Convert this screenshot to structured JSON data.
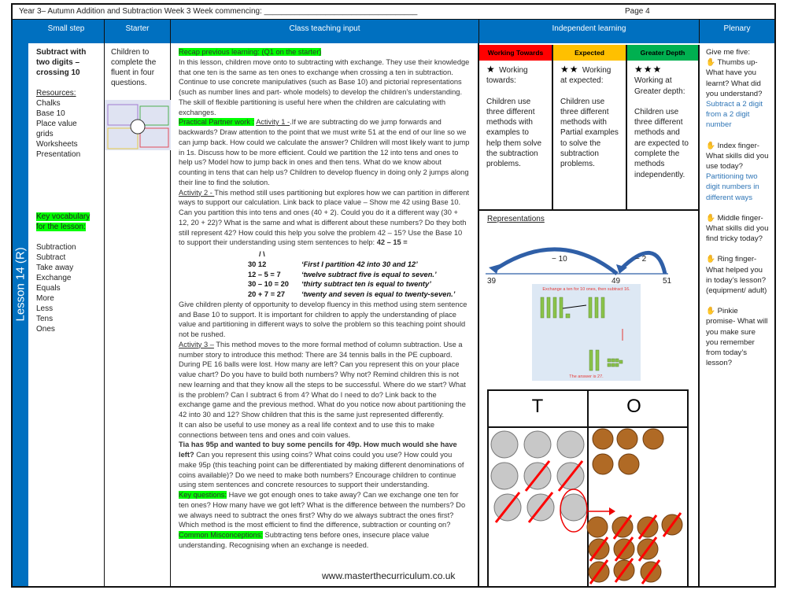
{
  "title": "Year 3– Autumn Addition and Subtraction Week 3   Week commencing: ___________________________________",
  "page": "Page 4",
  "lesson": "Lesson 14 (R)",
  "headers": {
    "small_step": "Small step",
    "starter": "Starter",
    "teaching": "Class teaching input",
    "independent": "Independent learning",
    "plenary": "Plenary"
  },
  "small_step": {
    "title": "Subtract with two digits – crossing 10",
    "resources_label": "Resources:",
    "resources": [
      "Chalks",
      "Base 10",
      "Place value grids",
      "Worksheets",
      "Presentation"
    ],
    "vocab_label": "Key vocabulary for the lesson:",
    "vocab": [
      "Subtraction",
      "Subtract",
      "Take away",
      "Exchange",
      "Equals",
      "More",
      "Less",
      "Tens",
      "Ones"
    ]
  },
  "starter": {
    "text": "Children to complete the fluent in four questions."
  },
  "teaching": {
    "paragraphs": [
      [
        {
          "t": "Recap previous learning: (Q1 on the starter)",
          "s": "hl"
        }
      ],
      [
        {
          "t": "In this lesson, children move onto to subtracting with exchange. They use their knowledge that one ten is the same as ten ones to exchange when crossing a ten in subtraction. Continue to use concrete manipulatives (such as Base 10) and pictorial representations (such as number lines and part- whole models) to develop the children’s understanding. The skill of flexible partitioning is useful here when the children are calculating with exchanges."
        }
      ],
      [
        {
          "t": "Practical Partner work :",
          "s": "hl"
        },
        {
          "t": " "
        },
        {
          "t": "Activity 1 -",
          "s": "u"
        },
        {
          "t": ".If we are subtracting do we jump forwards and backwards?  Draw attention to the point that  we must write 51 at the end of our line so we can jump back.  How could we calculate the answer? Children will most likely want to jump in 1s.  Discuss how to be more efficient.  Could we partition the 12 into tens and ones to help us?  Model how to jump back in ones and then tens.  What do we know about counting in tens that can help us?  Children to develop fluency in doing only 2 jumps along their line to find the solution."
        }
      ],
      [
        {
          "t": "Activity 2 -  ",
          "s": "u"
        },
        {
          "t": " This method still uses partitioning but explores how we can partition in different ways to support our calculation. Link back to place value – Show me 42 using Base 10.  Can you partition this into tens and ones (40 + 2).  Could you do it a different way (30 + 12, 20 + 22)?  What is the same and what is different about these numbers? Do they both still  represent 42? How could this help you solve the problem 42 – 15? Use the Base 10 to support their understanding using stem sentences to help:  "
        },
        {
          "t": "42 – 15 =",
          "s": "b"
        }
      ]
    ],
    "stems": {
      "branch": "/   \\",
      "rows": [
        [
          "30     12",
          "‘First I partition 42 into 30 and 12’"
        ],
        [
          "12 – 5 = 7",
          "‘twelve subtract five is equal to seven.’"
        ],
        [
          "30 –  10 = 20",
          "‘thirty subtract ten is equal to twenty’"
        ],
        [
          "20 + 7 = 27",
          "‘twenty and seven is equal to twenty-seven.’"
        ]
      ]
    },
    "paragraphs2": [
      [
        {
          "t": "Give children plenty of opportunity to develop fluency in this method using stem sentence and Base 10 to support. It is important for children to apply the understanding of place value and partitioning in different ways to solve the problem so this teaching point should not be rushed."
        }
      ],
      [
        {
          "t": "Activity 3 –",
          "s": "u"
        },
        {
          "t": " This method moves to the more formal method of column subtraction. Use a number story to introduce this method:  There are 34 tennis balls in the PE cupboard.  During PE 16 balls were lost. How many are left?  Can you represent this on your place value chart? Do you have to build both numbers? Why not?   Remind children this is not new learning and that they know all the steps to be successful. Where do we start?  What is the problem?  Can I subtract 6 from 4?  What do I need to do? Link back to the exchange game and the previous method.  What do you notice now about partitioning the 42 into 30 and 12?   Show children that this is the same just represented differently."
        }
      ],
      [
        {
          "t": "It can also  be useful to use money as a real life context and to use this to make connections between  tens and ones and coin values."
        }
      ],
      [
        {
          "t": "Tia has 95p and wanted to buy some pencils for 49p. How much would she have left?",
          "s": "b"
        },
        {
          "t": " Can you represent this using coins?  What coins could you use?  How could you make 95p  (this teaching point can be differentiated by making different denominations of coins available)?   Do we need to make both numbers?   Encourage children to continue using stem sentences and concrete resources to support their understanding."
        }
      ],
      [
        {
          "t": "Key questions:",
          "s": "hl"
        },
        {
          "t": " Have we got enough ones to take away? Can we exchange one ten for ten ones? How many have we got left? What is the difference between the numbers? Do we always need to subtract the ones first? Why do we always subtract the ones first?"
        }
      ],
      [
        {
          "t": "Which method is the most efficient to find the difference, subtraction or counting on?"
        }
      ],
      [
        {
          "t": "Common Misconceptions:",
          "s": "hl"
        },
        {
          "t": " Subtracting tens before ones, insecure place value understanding. Recognising when an exchange is needed."
        }
      ]
    ],
    "footer": "www.masterthecurriculum.co.uk"
  },
  "independent": {
    "levels": [
      {
        "label": "Working Towards",
        "color": "#ff0000",
        "stars": 1,
        "heading": "Working towards:",
        "text": "Children use three different methods with examples to help them solve the subtraction problems."
      },
      {
        "label": "Expected",
        "color": "#ffc000",
        "stars": 2,
        "heading": "Working at expected:",
        "text": "Children use three different methods with Partial examples to solve the subtraction problems."
      },
      {
        "label": "Greater Depth",
        "color": "#00b050",
        "stars": 3,
        "heading": "Working at Greater depth:",
        "text": "Children use three different methods and are expected to complete the methods independently."
      }
    ],
    "representations_label": "Representations",
    "numberline": {
      "labels": [
        "39",
        "49",
        "51"
      ],
      "jumps": [
        "− 10",
        "− 2"
      ]
    },
    "base10": {
      "caption": "Exchange a ten for 10 ones, then subtract 16.",
      "answer": "The answer is 27."
    },
    "pv_chart": {
      "headers": [
        "T",
        "O"
      ],
      "tens_coins": 9,
      "tens_crossed": 5,
      "ones_coins": 5,
      "exchanged_ones": 10,
      "ones_crossed": 9
    }
  },
  "plenary": {
    "intro": "Give me five:",
    "items": [
      {
        "q": "Thumbs up- What have you learnt? What did you understand?",
        "a": "Subtract a 2 digit from a 2 digit number"
      },
      {
        "q": "Index finger- What skills did you use today?",
        "a": "Partitioning two digit numbers in different ways"
      },
      {
        "q": "Middle finger- What skills did you find tricky today?"
      },
      {
        "q": "Ring finger- What helped you in today’s lesson? (equipment/ adult)"
      },
      {
        "q": "Pinkie promise- What will you make sure you remember from today’s lesson?"
      }
    ]
  },
  "colors": {
    "header_blue": "#0070c0",
    "highlight": "#00ff00",
    "answer_blue": "#2e75b6"
  }
}
